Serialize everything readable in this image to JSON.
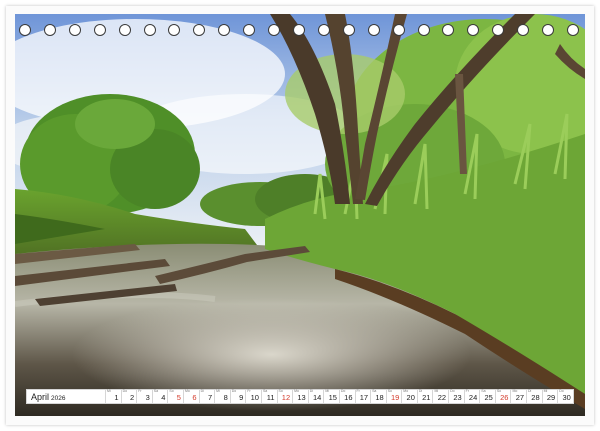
{
  "calendar": {
    "month_label": "April",
    "year_label": "2026",
    "days": [
      {
        "num": "1",
        "weekday": "Mi",
        "sunday": false
      },
      {
        "num": "2",
        "weekday": "Do",
        "sunday": false
      },
      {
        "num": "3",
        "weekday": "Fr",
        "sunday": false
      },
      {
        "num": "4",
        "weekday": "Sa",
        "sunday": false
      },
      {
        "num": "5",
        "weekday": "So",
        "sunday": true
      },
      {
        "num": "6",
        "weekday": "Mo",
        "sunday": true
      },
      {
        "num": "7",
        "weekday": "Di",
        "sunday": false
      },
      {
        "num": "8",
        "weekday": "Mi",
        "sunday": false
      },
      {
        "num": "9",
        "weekday": "Do",
        "sunday": false
      },
      {
        "num": "10",
        "weekday": "Fr",
        "sunday": false
      },
      {
        "num": "11",
        "weekday": "Sa",
        "sunday": false
      },
      {
        "num": "12",
        "weekday": "So",
        "sunday": true
      },
      {
        "num": "13",
        "weekday": "Mo",
        "sunday": false
      },
      {
        "num": "14",
        "weekday": "Di",
        "sunday": false
      },
      {
        "num": "15",
        "weekday": "Mi",
        "sunday": false
      },
      {
        "num": "16",
        "weekday": "Do",
        "sunday": false
      },
      {
        "num": "17",
        "weekday": "Fr",
        "sunday": false
      },
      {
        "num": "18",
        "weekday": "Sa",
        "sunday": false
      },
      {
        "num": "19",
        "weekday": "So",
        "sunday": true
      },
      {
        "num": "20",
        "weekday": "Mo",
        "sunday": false
      },
      {
        "num": "21",
        "weekday": "Di",
        "sunday": false
      },
      {
        "num": "22",
        "weekday": "Mi",
        "sunday": false
      },
      {
        "num": "23",
        "weekday": "Do",
        "sunday": false
      },
      {
        "num": "24",
        "weekday": "Fr",
        "sunday": false
      },
      {
        "num": "25",
        "weekday": "Sa",
        "sunday": false
      },
      {
        "num": "26",
        "weekday": "So",
        "sunday": true
      },
      {
        "num": "27",
        "weekday": "Mo",
        "sunday": false
      },
      {
        "num": "28",
        "weekday": "Di",
        "sunday": false
      },
      {
        "num": "29",
        "weekday": "Mi",
        "sunday": false
      },
      {
        "num": "30",
        "weekday": "Do",
        "sunday": false
      }
    ]
  },
  "binding": {
    "hole_count": 23
  },
  "colors": {
    "sunday": "#d43a2a",
    "text": "#222222",
    "grid": "#d6d6d6"
  }
}
